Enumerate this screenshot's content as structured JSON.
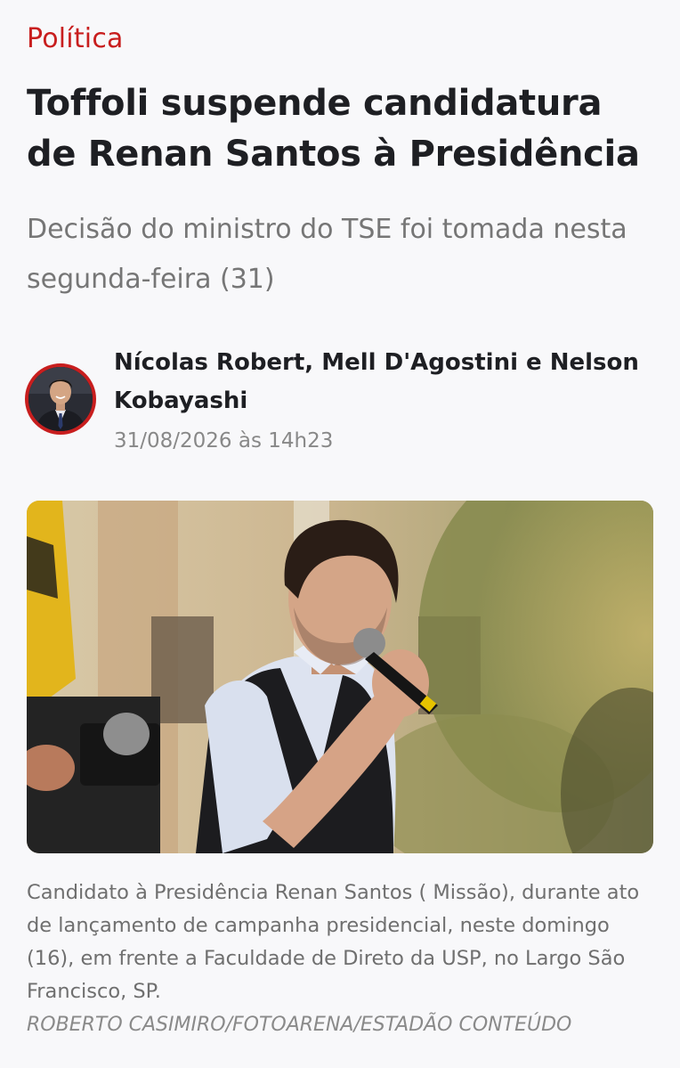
{
  "article": {
    "section": "Política",
    "headline": "Toffoli suspende candidatura de Renan Santos à Presidência",
    "subtitle": "Decisão do ministro do TSE foi tomada nesta segunda-feira (31)",
    "authors": "Nícolas Robert, Mell D'Agostini e Nelson Kobayashi",
    "date": "31/08/2026 às 14h23",
    "photo": {
      "caption": "Candidato à Presidência Renan Santos ( Missão), durante ato de lançamento de campanha presidencial, neste domingo (16), em frente a Faculdade de Direto da USP, no Largo São Francisco, SP.",
      "credit": "ROBERTO CASIMIRO/FOTOARENA/ESTADÃO CONTEÚDO"
    }
  },
  "colors": {
    "accent": "#c81e1e",
    "background": "#f8f8fa",
    "headline": "#1e1f23",
    "muted": "#767676"
  }
}
